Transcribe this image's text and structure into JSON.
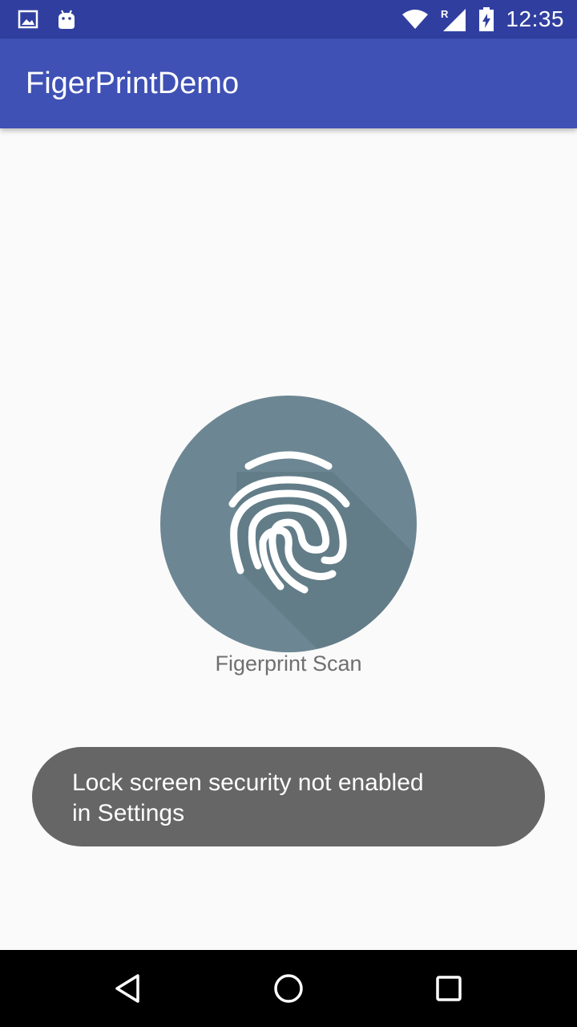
{
  "status_bar": {
    "time": "12:35",
    "left_icons": [
      "gallery-icon",
      "android-icon"
    ],
    "right_icons": [
      "wifi-icon",
      "signal-roaming-icon",
      "battery-charging-icon"
    ],
    "roaming_indicator": "R"
  },
  "app_bar": {
    "title": "FigerPrintDemo",
    "background_color": "#3f51b5",
    "status_color": "#303f9f"
  },
  "main": {
    "fingerprint_icon": "fingerprint-icon",
    "scan_label": "Figerprint Scan",
    "circle_color": "#6c8793"
  },
  "toast": {
    "message": "Lock screen security not enabled in Settings"
  },
  "nav_bar": {
    "buttons": [
      "back-icon",
      "home-icon",
      "recents-icon"
    ]
  }
}
